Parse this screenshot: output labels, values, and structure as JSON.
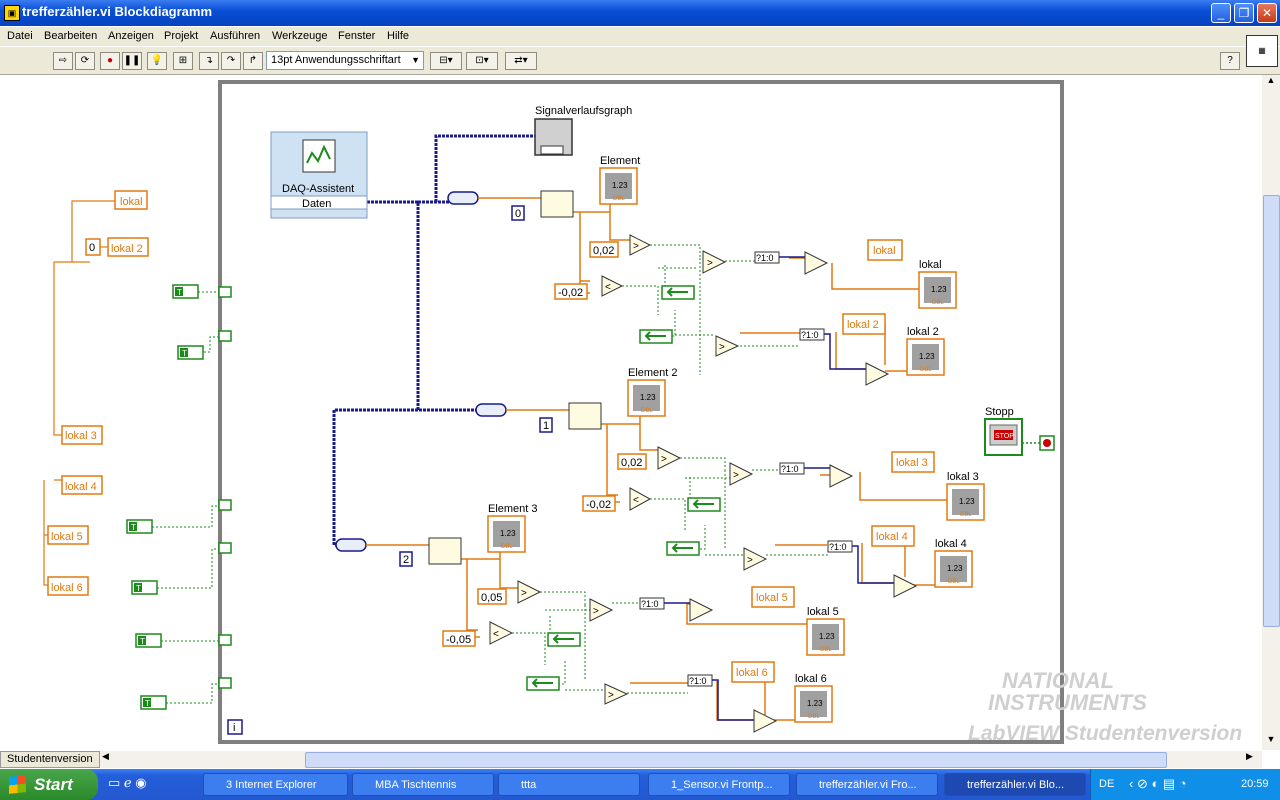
{
  "window": {
    "title": "trefferzähler.vi Blockdiagramm"
  },
  "menu": [
    "Datei",
    "Bearbeiten",
    "Anzeigen",
    "Projekt",
    "Ausführen",
    "Werkzeuge",
    "Fenster",
    "Hilfe"
  ],
  "toolbar": {
    "font_select": "13pt Anwendungsschriftart"
  },
  "diagram": {
    "daq": {
      "title": "DAQ-Assistent",
      "output": "Daten"
    },
    "graph_label": "Signalverlaufsgraph",
    "indicators": [
      {
        "label": "Element"
      },
      {
        "label": "Element 2"
      },
      {
        "label": "Element 3"
      },
      {
        "label": "lokal"
      },
      {
        "label": "lokal 2"
      },
      {
        "label": "lokal 3"
      },
      {
        "label": "lokal 4"
      },
      {
        "label": "lokal 5"
      },
      {
        "label": "lokal 6"
      }
    ],
    "indicator_text": "1.23",
    "indicator_type": "DBL",
    "index_constants": [
      "0",
      "1",
      "2"
    ],
    "thresholds": [
      "0,02",
      "-0,02",
      "0,02",
      "-0,02",
      "0,05",
      "-0,05"
    ],
    "local_var_labels": [
      "lokal",
      "lokal 2",
      "lokal 3",
      "lokal 4",
      "lokal 5",
      "lokal 6"
    ],
    "left_locals": [
      "lokal",
      "lokal 2",
      "lokal 3",
      "lokal 4",
      "lokal 5",
      "lokal 6"
    ],
    "left_zero": "0",
    "bool_text": "?1:0",
    "stop_label": "Stopp",
    "stop_text": "STOP",
    "iteration": "i",
    "true_const": "T"
  },
  "status": {
    "tab": "Studentenversion"
  },
  "watermark": {
    "line1": "NATIONAL",
    "line2": "INSTRUMENTS",
    "line3": "LabVIEW Studentenversion"
  },
  "taskbar": {
    "start": "Start",
    "items": [
      "3 Internet Explorer",
      "MBA Tischtennis",
      "ttta",
      "1_Sensor.vi Frontp...",
      "trefferzähler.vi Fro...",
      "trefferzähler.vi Blo..."
    ],
    "lang": "DE",
    "clock": "20:59"
  },
  "colors": {
    "orange": "#e07a10",
    "blue_wire": "#1a1a8c",
    "green": "#1d8a1d",
    "loop_gray": "#7f7f7f"
  }
}
